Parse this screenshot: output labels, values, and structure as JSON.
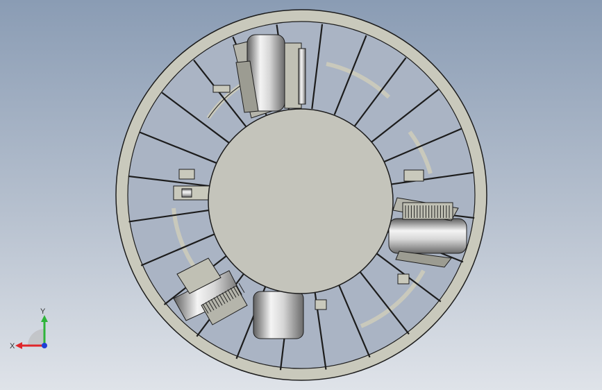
{
  "viewport": {
    "background_top": "#8a9cb4",
    "background_bottom": "#dfe3e9"
  },
  "model": {
    "face_color": "#c9c9bc",
    "edge_color": "#1c1c1c",
    "hub_color": "#c4c4bb",
    "metal_dark": "#6e6e6e",
    "metal_light": "#f2f2f2",
    "spoke_count": 24
  },
  "triad": {
    "x_label": "X",
    "y_label": "Y",
    "x_color": "#e0262a",
    "y_color": "#2fb43a",
    "z_color": "#1f3fd6",
    "icon": "coordinate-triad-icon"
  }
}
